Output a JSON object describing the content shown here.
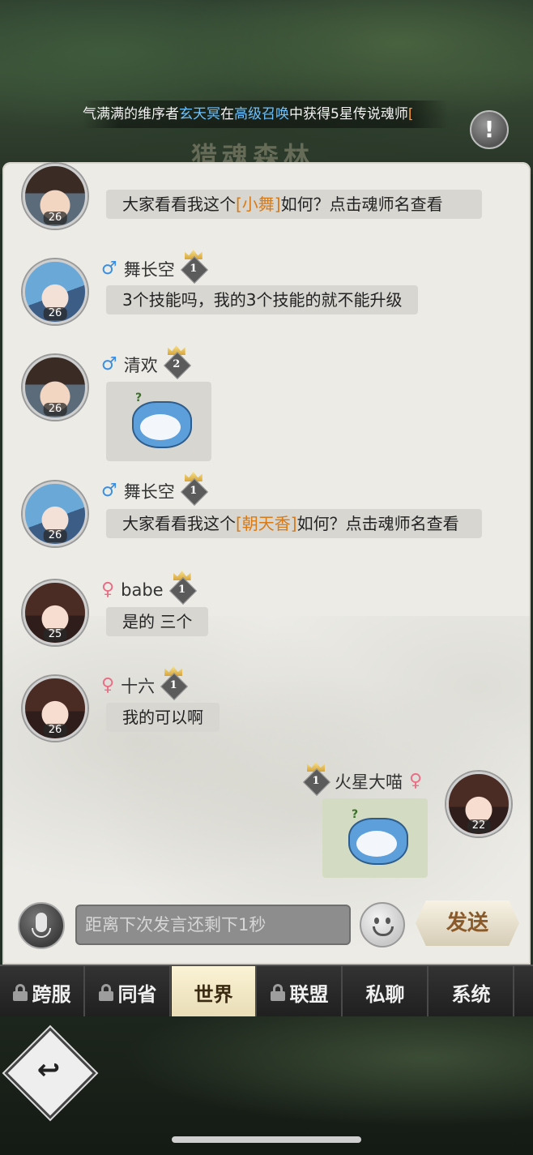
{
  "ticker": {
    "prefix": "气满满的维序者",
    "player": "玄天冥",
    "mid1": "在",
    "event": "高级召唤",
    "mid2": "中获得5星传说魂师",
    "bracket": "["
  },
  "background_title": "猎魂森林",
  "alert_icon_glyph": "!",
  "messages": [
    {
      "level": "26",
      "text_before": "大家看看我这个",
      "tag": "[小舞]",
      "text_after": "如何？点击魂师名查看"
    },
    {
      "gender": "♂",
      "name": "舞长空",
      "rank": "1",
      "level": "26",
      "text": "3个技能吗，我的3个技能的就不能升级"
    },
    {
      "gender": "♂",
      "name": "清欢",
      "rank": "2",
      "level": "26"
    },
    {
      "gender": "♂",
      "name": "舞长空",
      "rank": "1",
      "level": "26",
      "text_before": "大家看看我这个",
      "tag": "[朝天香]",
      "text_after": "如何？点击魂师名查看"
    },
    {
      "gender": "♀",
      "name": "babe",
      "rank": "1",
      "level": "25",
      "text": "是的 三个"
    },
    {
      "gender": "♀",
      "name": "十六",
      "rank": "1",
      "level": "26",
      "text": "我的可以啊"
    },
    {
      "gender": "♀",
      "name": "火星大喵",
      "rank": "1",
      "level": "22"
    }
  ],
  "input": {
    "placeholder": "距离下次发言还剩下1秒",
    "send_label": "发送"
  },
  "tabs": [
    {
      "label": "跨服",
      "locked": true
    },
    {
      "label": "同省",
      "locked": true
    },
    {
      "label": "世界",
      "locked": false,
      "active": true
    },
    {
      "label": "联盟",
      "locked": true
    },
    {
      "label": "私聊",
      "locked": false
    },
    {
      "label": "系统",
      "locked": false
    }
  ],
  "colors": {
    "male": "#3a8fe0",
    "female": "#ea6f86",
    "tag": "#d87a16",
    "link": "#6ec3ff"
  }
}
